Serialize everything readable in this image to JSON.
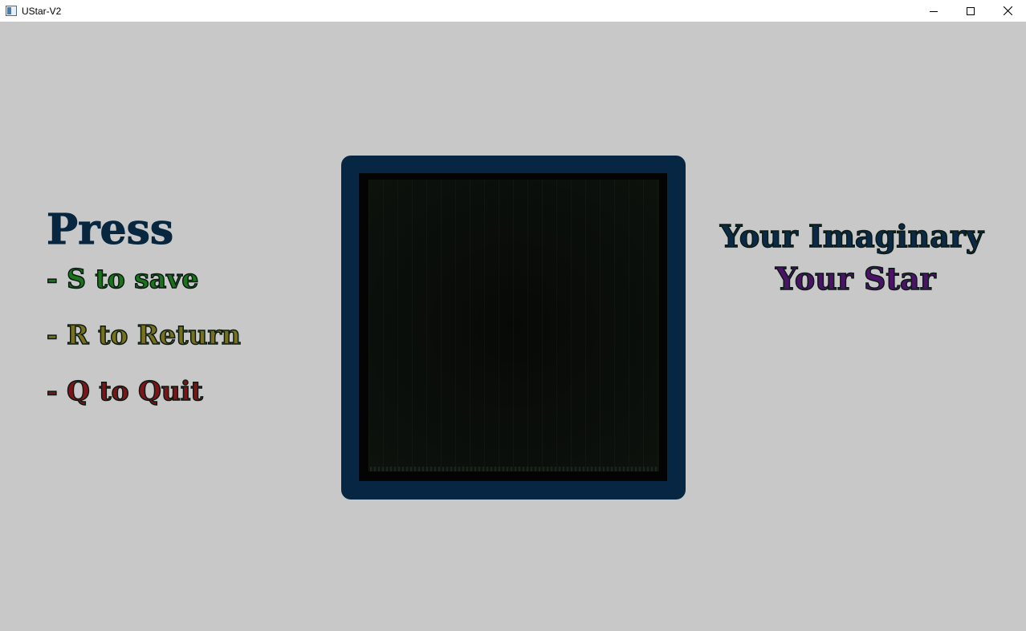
{
  "window": {
    "title": "UStar-V2",
    "icon": "app-window-icon",
    "controls": [
      "minimize-icon",
      "maximize-icon",
      "close-icon"
    ]
  },
  "menu": {
    "heading": "Press",
    "items": [
      {
        "label": "- S to save",
        "color": "#1a7419"
      },
      {
        "label": "- R to Return",
        "color": "#78701a"
      },
      {
        "label": "- Q to Quit",
        "color": "#7c1418"
      }
    ],
    "heading_color": "#07263f"
  },
  "caption": {
    "line1": "Your Imaginary",
    "line2": "Your Star",
    "line1_color": "#0a2a48",
    "line2_color": "#4c1268"
  },
  "canvas": {
    "frame_color": "#062644",
    "fill_color": "#030403"
  },
  "colors": {
    "background": "#c8c8c8",
    "titlebar": "#ffffff"
  }
}
